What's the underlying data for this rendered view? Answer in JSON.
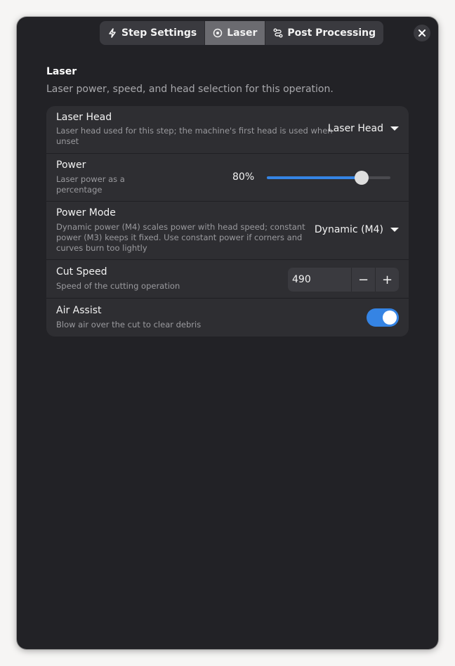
{
  "tabs": [
    {
      "label": "Step Settings",
      "icon": "bolt-icon",
      "active": false
    },
    {
      "label": "Laser",
      "icon": "target-icon",
      "active": true
    },
    {
      "label": "Post Processing",
      "icon": "route-icon",
      "active": false
    }
  ],
  "section": {
    "title": "Laser",
    "description": "Laser power, speed, and head selection for this operation."
  },
  "rows": {
    "laser_head": {
      "title": "Laser Head",
      "subtitle_line1": "Laser head used for this step; the machine's first head is used when",
      "subtitle_line2": "unset",
      "value": "Laser Head"
    },
    "power": {
      "title": "Power",
      "subtitle_line1": "Laser power as a",
      "subtitle_line2": "percentage",
      "value_label": "80%",
      "value": 0.8
    },
    "power_mode": {
      "title": "Power Mode",
      "subtitle_line1": "Dynamic power (M4) scales power with head speed; constant",
      "subtitle_line2": "power (M3) keeps it fixed. Use constant power if corners and",
      "subtitle_line3": "curves burn too lightly",
      "value": "Dynamic (M4)"
    },
    "cut_speed": {
      "title": "Cut Speed",
      "subtitle": "Speed of the cutting operation",
      "value": "490",
      "decrement": "−",
      "increment": "+"
    },
    "air_assist": {
      "title": "Air Assist",
      "subtitle": "Blow air over the cut to clear debris",
      "enabled": true
    }
  },
  "colors": {
    "accent": "#3584e4",
    "window_bg": "#222226",
    "card_bg": "#2e2e32"
  }
}
